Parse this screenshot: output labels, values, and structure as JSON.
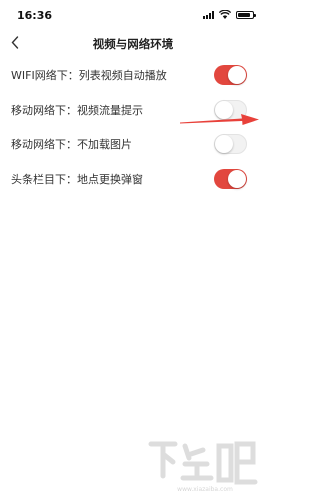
{
  "status_bar": {
    "time": "16:36",
    "icons": [
      "signal-icon",
      "wifi-icon",
      "battery-icon"
    ]
  },
  "nav": {
    "back_icon": "chevron-left-icon",
    "title": "视频与网络环境"
  },
  "settings": [
    {
      "label": "WIFI网络下：列表视频自动播放",
      "enabled": true
    },
    {
      "label": "移动网络下：视频流量提示",
      "enabled": false
    },
    {
      "label": "移动网络下：不加载图片",
      "enabled": false
    },
    {
      "label": "头条栏目下：地点更换弹窗",
      "enabled": true
    }
  ],
  "colors": {
    "toggle_on": "#e2473e",
    "toggle_off": "#f2f2f2",
    "annotation_arrow": "#e8413a"
  },
  "annotation": {
    "icon": "red-arrow-icon"
  },
  "watermark": {
    "text": "下载吧",
    "url_text": "www.xiazaiba.com"
  }
}
